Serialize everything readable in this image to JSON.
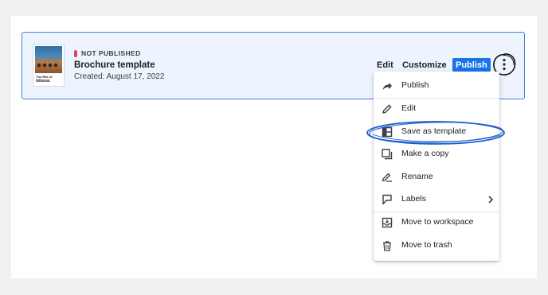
{
  "card": {
    "status": "NOT PUBLISHED",
    "title": "Brochure template",
    "created": "Created: August 17, 2022",
    "thumbnail_title": "The Rite of Diffusion",
    "actions": {
      "edit": "Edit",
      "customize": "Customize",
      "publish": "Publish"
    },
    "more_icon": "more-vertical-icon"
  },
  "menu": {
    "items": [
      {
        "label": "Publish",
        "icon": "share-arrow-icon"
      },
      {
        "label": "Edit",
        "icon": "pencil-icon"
      },
      {
        "label": "Save as template",
        "icon": "template-grid-icon"
      },
      {
        "label": "Make a copy",
        "icon": "copy-icon"
      },
      {
        "label": "Rename",
        "icon": "rename-icon"
      },
      {
        "label": "Labels",
        "icon": "label-icon",
        "has_submenu": true
      },
      {
        "label": "Move to workspace",
        "icon": "move-to-inbox-icon"
      },
      {
        "label": "Move to trash",
        "icon": "trash-icon"
      }
    ]
  },
  "colors": {
    "accent": "#1a73e8",
    "card_border": "#3d7ee6",
    "card_bg": "#eef4fe",
    "status_dot": "#e8405c",
    "annotation_ring": "#1a5fd0"
  }
}
